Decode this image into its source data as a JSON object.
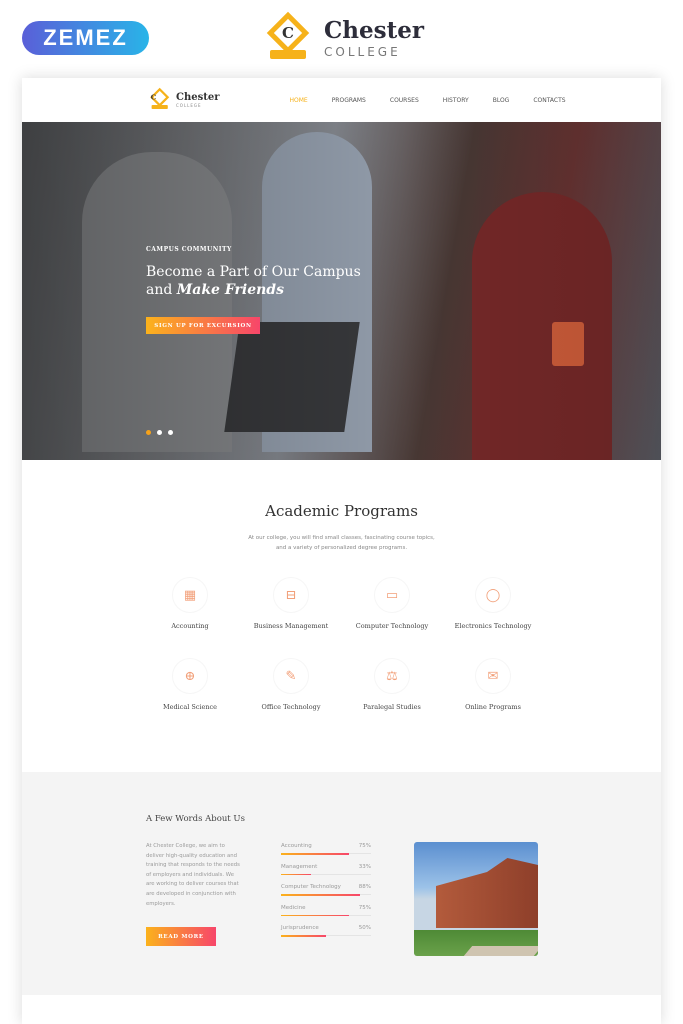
{
  "vendor": {
    "logo": "ZEMEZ"
  },
  "brand": {
    "name": "Chester",
    "sub": "COLLEGE",
    "initial": "C"
  },
  "nav": {
    "items": [
      "HOME",
      "PROGRAMS",
      "COURSES",
      "HISTORY",
      "BLOG",
      "CONTACTS"
    ],
    "active": "HOME"
  },
  "hero": {
    "kicker": "CAMPUS COMMUNITY",
    "title_line1": "Become a Part of Our Campus",
    "title_line2_pre": "and ",
    "title_line2_bold": "Make Friends",
    "cta": "SIGN UP FOR EXCURSION",
    "slides": 3,
    "active_slide": 1
  },
  "programs": {
    "title": "Academic Programs",
    "description": "At our college, you will find small classes, fascinating course topics, and a variety of personalized degree programs.",
    "items": [
      {
        "label": "Accounting",
        "icon": "calculator-icon"
      },
      {
        "label": "Business Management",
        "icon": "briefcase-icon"
      },
      {
        "label": "Computer Technology",
        "icon": "computer-icon"
      },
      {
        "label": "Electronics Technology",
        "icon": "chip-icon"
      },
      {
        "label": "Medical Science",
        "icon": "medical-kit-icon"
      },
      {
        "label": "Office Technology",
        "icon": "document-edit-icon"
      },
      {
        "label": "Paralegal Studies",
        "icon": "scales-icon"
      },
      {
        "label": "Online Programs",
        "icon": "chat-icon"
      }
    ]
  },
  "about": {
    "title": "A Few Words About Us",
    "text": "At Chester College, we aim to deliver high-quality education and training that responds to the needs of employers and individuals. We are working to deliver courses that are developed in conjunction with employers.",
    "cta": "READ MORE",
    "skills": [
      {
        "name": "Accounting",
        "value": 75,
        "label": "75%"
      },
      {
        "name": "Management",
        "value": 33,
        "label": "33%"
      },
      {
        "name": "Computer Technology",
        "value": 88,
        "label": "88%"
      },
      {
        "name": "Medicine",
        "value": 75,
        "label": "75%"
      },
      {
        "name": "Jurisprudence",
        "value": 50,
        "label": "50%"
      }
    ]
  },
  "colors": {
    "accent": "#f6b21a",
    "gradient_start": "#fbb21c",
    "gradient_end": "#f7466a",
    "icon": "#f2a07a"
  }
}
